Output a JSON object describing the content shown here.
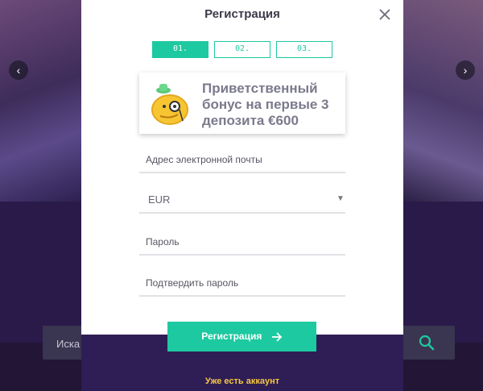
{
  "background": {
    "search_placeholder": "Иска"
  },
  "modal": {
    "title": "Регистрация",
    "steps": [
      "01.",
      "02.",
      "03."
    ],
    "bonus": {
      "text": "Приветственный бонус на первые 3 депозита €600",
      "icon": "monocle-smiley-icon"
    },
    "fields": {
      "email_label": "Адрес электронной почты",
      "currency_value": "EUR",
      "password_label": "Пароль",
      "confirm_password_label": "Подтвердить пароль"
    },
    "submit_label": "Регистрация",
    "have_account": "Уже есть аккаунт"
  },
  "colors": {
    "accent": "#1dc9a0",
    "footer": "#2f1d55",
    "link": "#f5c842"
  }
}
